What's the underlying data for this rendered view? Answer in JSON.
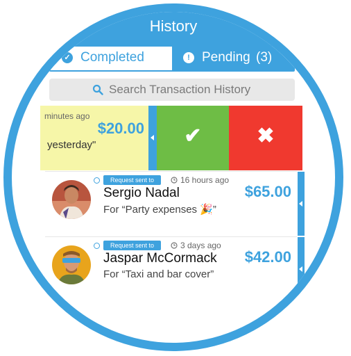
{
  "header": {
    "title": "History"
  },
  "tabs": {
    "completed": {
      "label": "Completed",
      "icon": "check-circle-icon"
    },
    "pending": {
      "label": "Pending",
      "count": "(3)",
      "icon": "exclamation-circle-icon"
    }
  },
  "search": {
    "placeholder": "Search Transaction History",
    "icon": "search-icon"
  },
  "swiped_item": {
    "time": "minutes ago",
    "amount": "$20.00",
    "note": "yesterday\"",
    "accept_icon": "check-icon",
    "decline_icon": "x-icon"
  },
  "transactions": [
    {
      "status": "Request sent to",
      "time": "16 hours ago",
      "name": "Sergio Nadal",
      "note": "For “Party expenses 🎉”",
      "amount": "$65.00"
    },
    {
      "status": "Request sent to",
      "time": "3 days ago",
      "name": "Jaspar McCormack",
      "note": "For “Taxi and bar cover”",
      "amount": "$42.00"
    }
  ],
  "colors": {
    "accent": "#3ea2de",
    "accept": "#6ebd45",
    "decline": "#f0392f",
    "pending_card": "#f6f6a8"
  }
}
